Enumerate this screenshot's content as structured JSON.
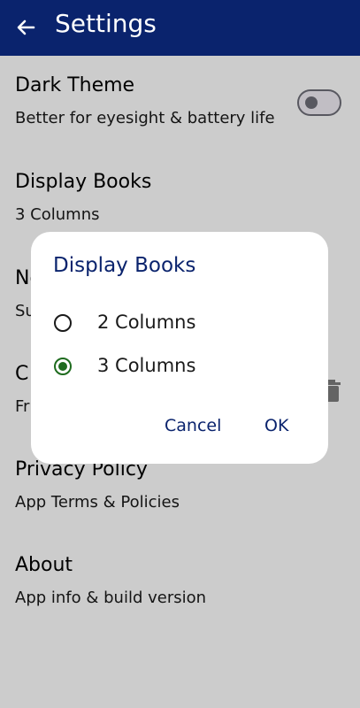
{
  "appbar": {
    "title": "Settings",
    "back_icon": "arrow-back-icon"
  },
  "settings": {
    "dark_theme": {
      "title": "Dark Theme",
      "subtitle": "Better for eyesight & battery life",
      "toggle_on": false
    },
    "display_books": {
      "title": "Display Books",
      "subtitle": "3 Columns"
    },
    "notifications": {
      "title": "No",
      "subtitle": "Su"
    },
    "clear": {
      "title": "C",
      "subtitle": "Fr",
      "icon": "trash-icon"
    },
    "privacy": {
      "title": "Privacy Policy",
      "subtitle": "App Terms & Policies"
    },
    "about": {
      "title": "About",
      "subtitle": "App info & build version"
    }
  },
  "dialog": {
    "title": "Display Books",
    "options": [
      {
        "label": "2 Columns",
        "selected": false
      },
      {
        "label": "3 Columns",
        "selected": true
      }
    ],
    "cancel_label": "Cancel",
    "ok_label": "OK"
  },
  "colors": {
    "appbar": "#0a236d",
    "accent_green": "#1e6b1e"
  }
}
